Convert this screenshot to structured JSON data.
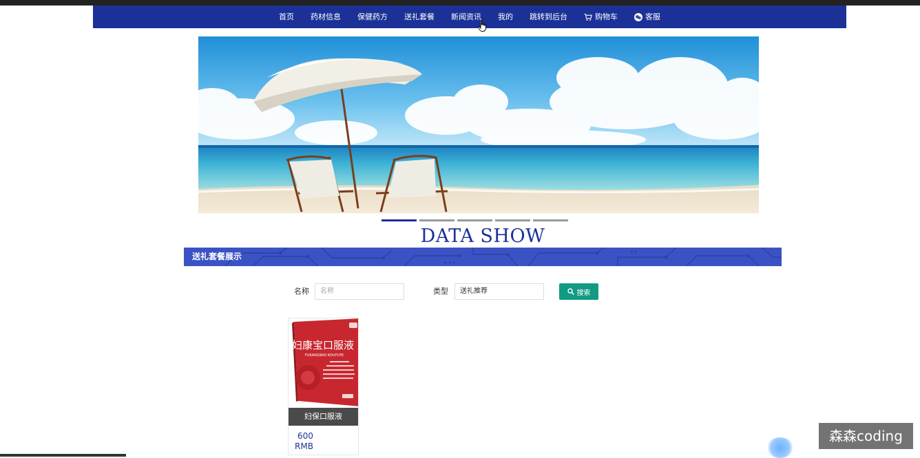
{
  "nav": {
    "items": [
      {
        "label": "首页"
      },
      {
        "label": "药材信息"
      },
      {
        "label": "保健药方"
      },
      {
        "label": "送礼套餐"
      },
      {
        "label": "新闻资讯"
      },
      {
        "label": "我的"
      },
      {
        "label": "跳转到后台"
      },
      {
        "label": "购物车",
        "icon": "cart-icon"
      },
      {
        "label": "客服",
        "icon": "chat-icon"
      }
    ]
  },
  "carousel": {
    "slide_count": 5,
    "active_index": 0
  },
  "section": {
    "title": "DATA SHOW",
    "bar_label": "送礼套餐展示"
  },
  "search": {
    "name_label": "名称",
    "name_placeholder": "名称",
    "name_value": "",
    "type_label": "类型",
    "type_value": "送礼推荐",
    "button_label": "搜索"
  },
  "products": [
    {
      "name": "妇保口服液",
      "price": "600",
      "currency": "RMB",
      "box_text": "妇康宝口服液",
      "box_subtext": "FUKANGBAO KOUFUYE"
    }
  ],
  "watermark": {
    "text": "森森coding"
  },
  "colors": {
    "nav_bg": "#1b3197",
    "bar_bg": "#3b52c4",
    "button_bg": "#129a83"
  }
}
